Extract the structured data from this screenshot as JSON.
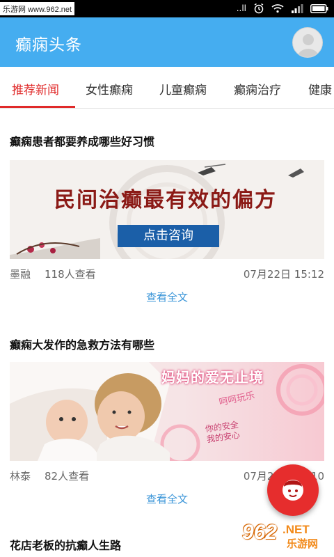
{
  "status_bar": {
    "watermark_text": "乐游网 www.962.net",
    "signal_label": "..ll",
    "icons": [
      "alarm-icon",
      "wifi-icon",
      "signal-icon",
      "battery-icon"
    ]
  },
  "app_bar": {
    "title": "癫痫头条",
    "background": "#45adf0",
    "avatar_icon": "avatar-icon"
  },
  "tabs": {
    "items": [
      {
        "label": "推荐新闻",
        "active": true
      },
      {
        "label": "女性癫痫",
        "active": false
      },
      {
        "label": "儿童癫痫",
        "active": false
      },
      {
        "label": "癫痫治疗",
        "active": false
      },
      {
        "label": "健康",
        "active": false
      }
    ],
    "active_color": "#e02a2a"
  },
  "articles": [
    {
      "title": "癫痫患者都要养成哪些好习惯",
      "image": {
        "headline": "民间治癫最有效的偏方",
        "button": "点击咨询"
      },
      "author": "墨融",
      "views": "118人查看",
      "time": "07月22日 15:12",
      "read_more": "查看全文"
    },
    {
      "title": "癫痫大发作的急救方法有哪些",
      "image": {
        "headline": "妈妈的爱无止境",
        "tagline": "呵呵玩乐",
        "caption_line1": "你的安全",
        "caption_line2": "我的安心"
      },
      "author": "林泰",
      "views": "82人查看",
      "time": "07月22日 15:10",
      "read_more": "查看全文"
    },
    {
      "title": "花店老板的抗癫人生路"
    }
  ],
  "fab": {
    "icon": "face-icon",
    "color": "#e62d2d"
  },
  "bottom_watermark": {
    "brand": "962",
    "suffix": ".NET",
    "cn": "乐游网"
  }
}
